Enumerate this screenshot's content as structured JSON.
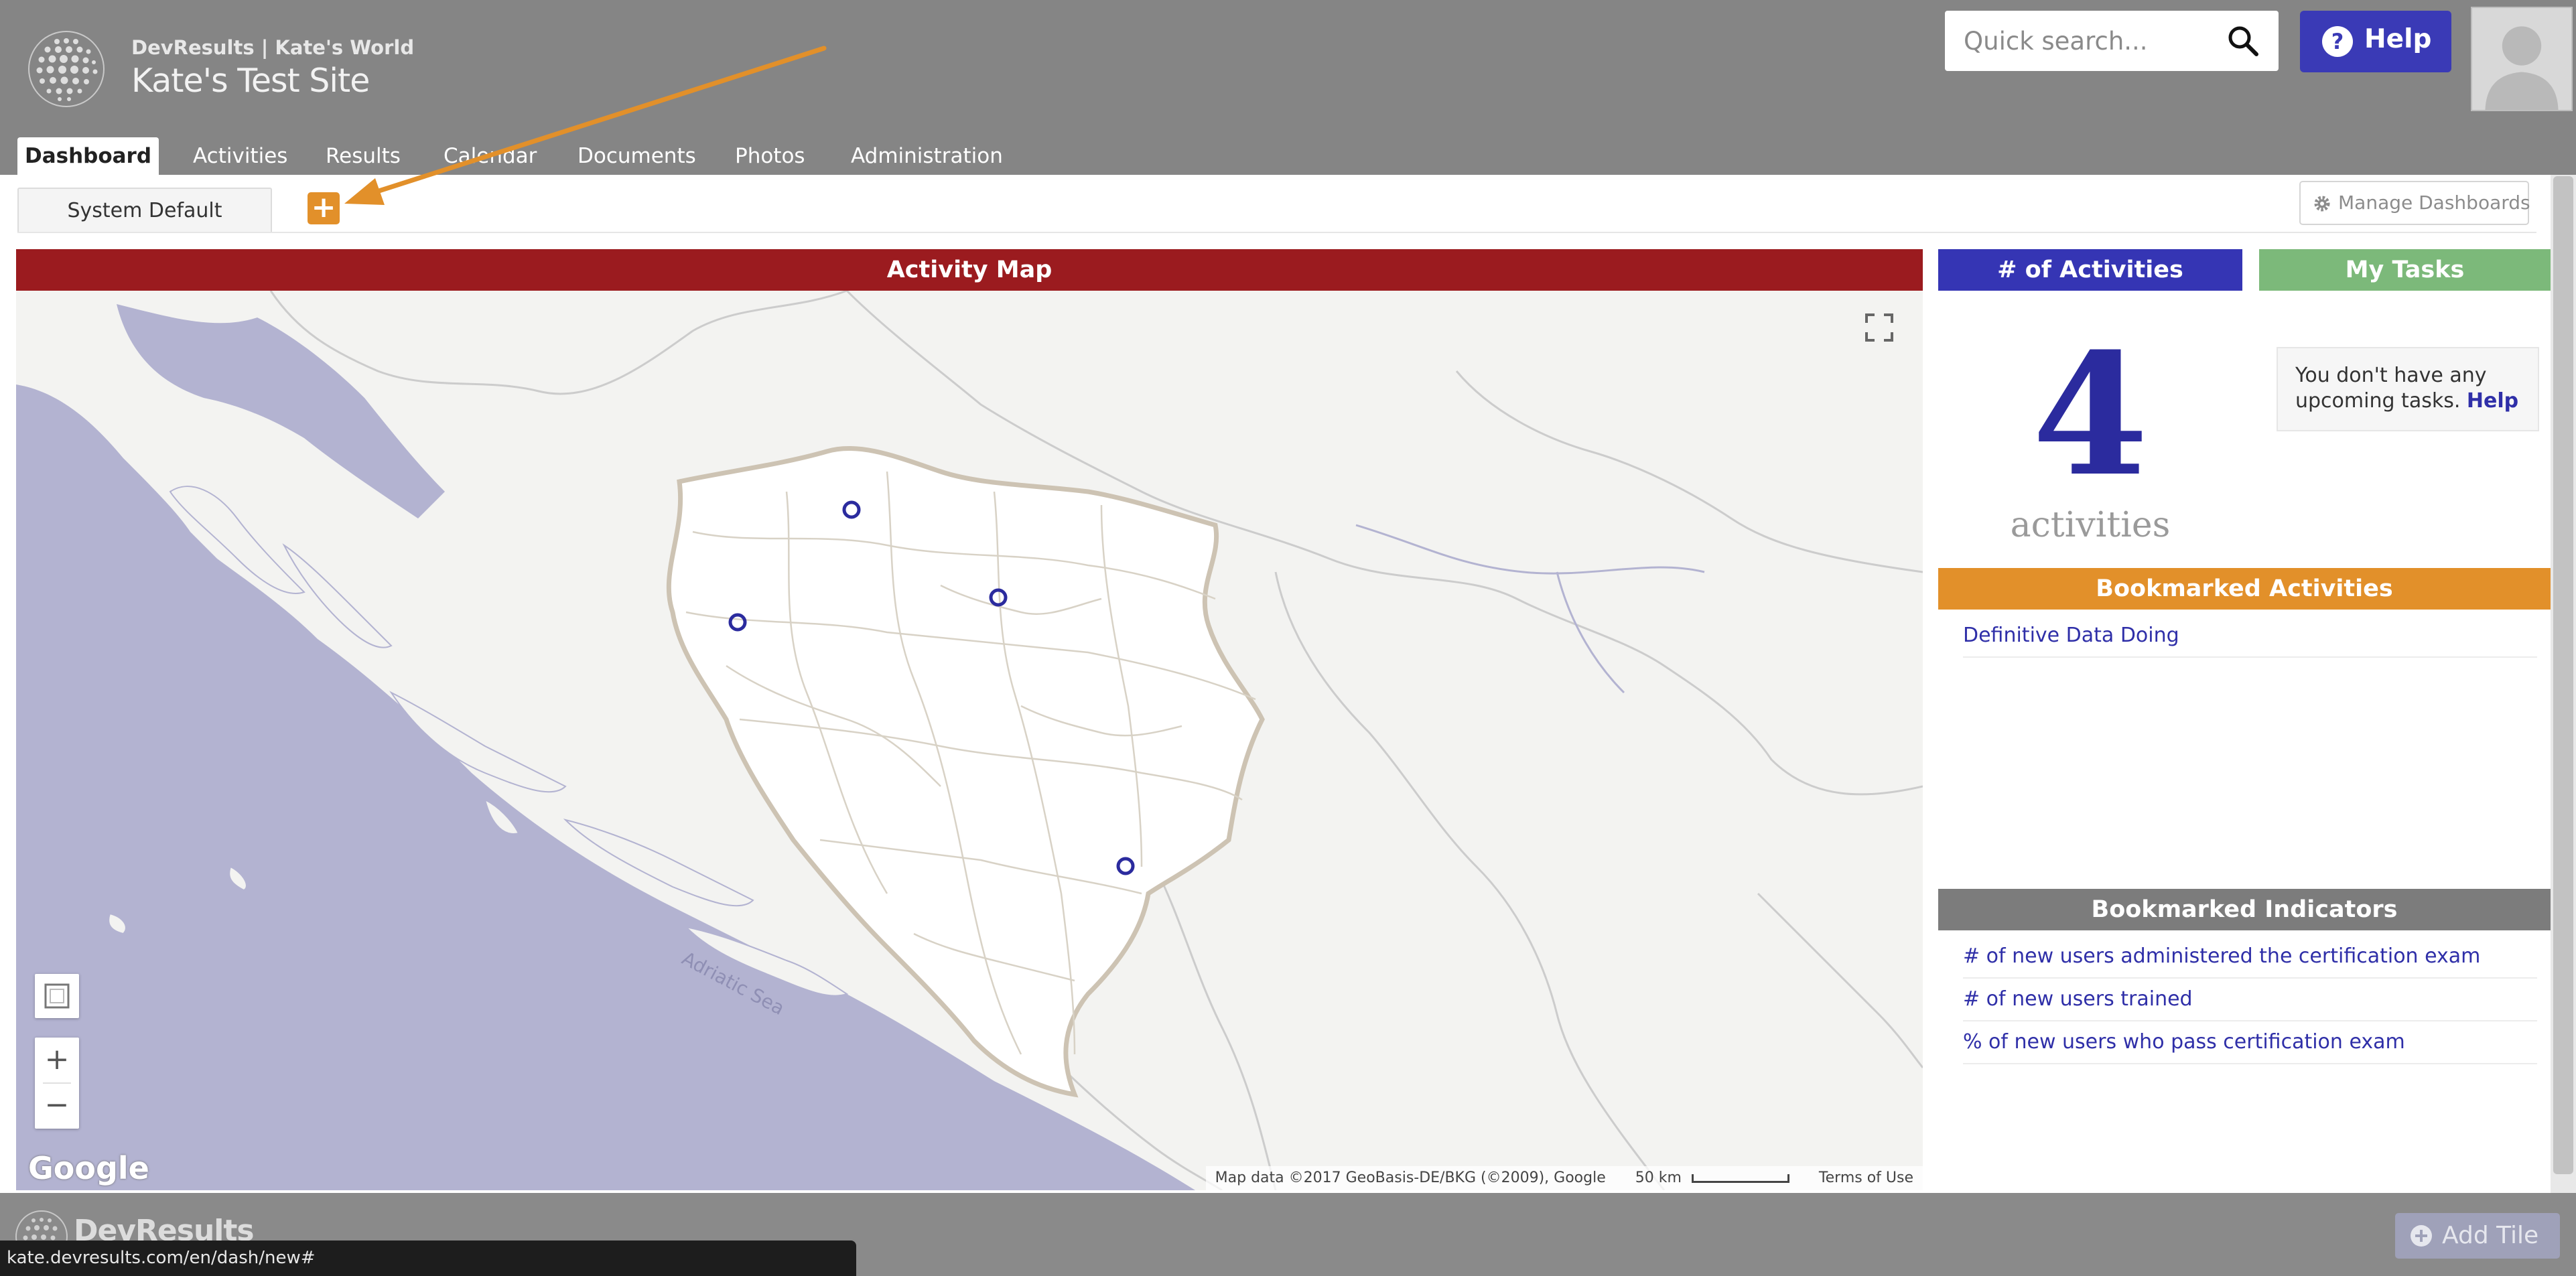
{
  "header": {
    "org_line": "DevResults | Kate's World",
    "site_title": "Kate's Test Site",
    "search_placeholder": "Quick search...",
    "help_label": "Help"
  },
  "nav": {
    "tabs": [
      {
        "label": "Dashboard",
        "active": true
      },
      {
        "label": "Activities"
      },
      {
        "label": "Results"
      },
      {
        "label": "Calendar"
      },
      {
        "label": "Documents"
      },
      {
        "label": "Photos"
      },
      {
        "label": "Administration"
      }
    ]
  },
  "dashboards": {
    "tab_label": "System Default",
    "add_label": "+",
    "manage_label": "Manage Dashboards"
  },
  "activity_map": {
    "title": "Activity Map",
    "sea_label": "Adriatic Sea",
    "google_logo": "Google",
    "attribution": "Map data ©2017 GeoBasis-DE/BKG (©2009), Google",
    "scale_label": "50 km",
    "terms": "Terms of Use",
    "zoom_in": "+",
    "zoom_out": "−"
  },
  "activity_count": {
    "title": "# of Activities",
    "count": "4",
    "unit": "activities"
  },
  "my_tasks": {
    "title": "My Tasks",
    "empty_text": "You don't have any upcoming tasks.",
    "help_link": "Help"
  },
  "bookmarked_activities": {
    "title": "Bookmarked Activities",
    "items": [
      "Definitive Data Doing"
    ]
  },
  "bookmarked_indicators": {
    "title": "Bookmarked Indicators",
    "items": [
      "# of new users administered the certification exam",
      "# of new users trained",
      "% of new users who pass certification exam"
    ]
  },
  "footer": {
    "brand": "DevResults",
    "add_tile_label": "Add Tile",
    "status_url": "kate.devresults.com/en/dash/new#"
  },
  "colors": {
    "map_header": "#9b1b1f",
    "count_header": "#3535b4",
    "tasks_header": "#7cb97a",
    "bookmarked_activities_header": "#e2902a",
    "bookmarked_indicators_header": "#7c7c7c",
    "link": "#2f2fa8",
    "annotation_arrow": "#e2902a"
  }
}
